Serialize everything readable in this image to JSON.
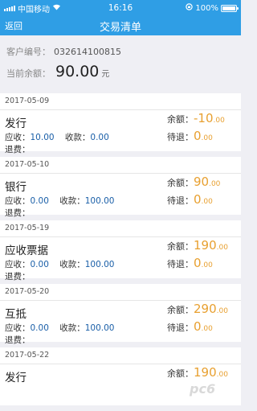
{
  "status_bar": {
    "carrier": "中国移动",
    "time": "16:16",
    "battery_text": "100%",
    "icons": [
      "signal-icon",
      "wifi-icon",
      "lock-rotation-icon",
      "battery-icon"
    ]
  },
  "nav": {
    "back_label": "返回",
    "title": "交易清单"
  },
  "account": {
    "id_label": "客户编号：",
    "id_value": "032614100815",
    "balance_label": "当前余额：",
    "balance_value": "90.00",
    "unit": "元"
  },
  "labels": {
    "receivable": "应收：",
    "collected": "收款：",
    "refund": "退费：",
    "balance": "余额：",
    "pending": "待退："
  },
  "transactions": [
    {
      "date": "2017-05-09",
      "type": "发行",
      "receivable": "10.00",
      "collected": "0.00",
      "refund": "",
      "balance_int": "-10",
      "balance_dec": ".00",
      "pending_int": "0",
      "pending_dec": ".00"
    },
    {
      "date": "2017-05-10",
      "type": "银行",
      "receivable": "0.00",
      "collected": "100.00",
      "refund": "",
      "balance_int": "90",
      "balance_dec": ".00",
      "pending_int": "0",
      "pending_dec": ".00"
    },
    {
      "date": "2017-05-19",
      "type": "应收票据",
      "receivable": "0.00",
      "collected": "100.00",
      "refund": "",
      "balance_int": "190",
      "balance_dec": ".00",
      "pending_int": "0",
      "pending_dec": ".00"
    },
    {
      "date": "2017-05-20",
      "type": "互抵",
      "receivable": "0.00",
      "collected": "100.00",
      "refund": "",
      "balance_int": "290",
      "balance_dec": ".00",
      "pending_int": "0",
      "pending_dec": ".00"
    },
    {
      "date": "2017-05-22",
      "type": "发行",
      "receivable": "",
      "collected": "",
      "refund": "",
      "balance_int": "190",
      "balance_dec": ".00",
      "pending_int": "",
      "pending_dec": ""
    }
  ],
  "colors": {
    "primary": "#2f9ee5",
    "accent": "#e8a030",
    "value_blue": "#1a5fa8",
    "background": "#efeff4"
  },
  "watermark": "pc6"
}
